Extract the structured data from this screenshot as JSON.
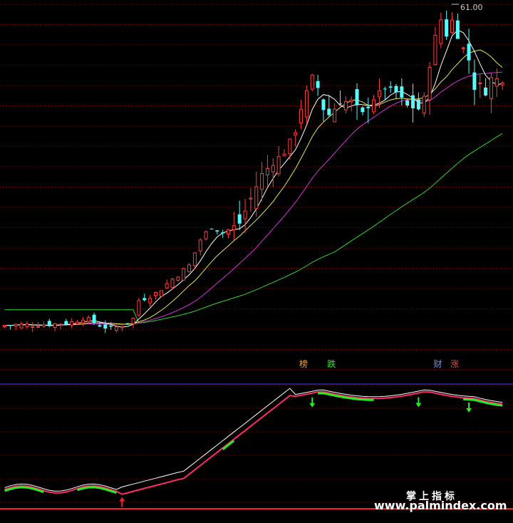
{
  "colors": {
    "up": "#ff3c3c",
    "down": "#54fcfc",
    "ma_white": "#ffffff",
    "ma_yellow": "#e6e64a",
    "ma_magenta": "#d42fd4",
    "ma_green": "#2bd42b",
    "grid": "#8b0000",
    "blue_line": "#3a3aff",
    "red_line": "#ff2020",
    "osc_line": "#ff2a6a",
    "osc_green": "#22ee22",
    "arrow_down": "#22ee22",
    "arrow_up": "#ff2020"
  },
  "chart_data": {
    "type": "candlestick",
    "price_label": "61.00",
    "signal_tags": [
      {
        "text": "榜",
        "color": "#e8a040",
        "index": 53
      },
      {
        "text": "跌",
        "color": "#22ee22",
        "index": 58
      },
      {
        "text": "财",
        "color": "#6699ff",
        "index": 77
      },
      {
        "text": "涨",
        "color": "#ff3c3c",
        "index": 80
      }
    ],
    "watermark": {
      "line1": "掌上指标",
      "line2": "www.palmindex.com"
    }
  }
}
